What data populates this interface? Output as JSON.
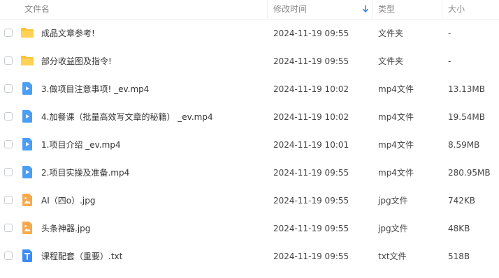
{
  "header": {
    "name": "文件名",
    "modified": "修改时间",
    "type": "类型",
    "size": "大小"
  },
  "files": [
    {
      "name": "成品文章参考!",
      "date": "2024-11-19 09:55",
      "type": "文件夹",
      "size": "-",
      "icon": "folder-icon"
    },
    {
      "name": "部分收益图及指令!",
      "date": "2024-11-19 09:55",
      "type": "文件夹",
      "size": "-",
      "icon": "folder-icon"
    },
    {
      "name": "3.做项目注意事项! _ev.mp4",
      "date": "2024-11-19 10:02",
      "type": "mp4文件",
      "size": "13.13MB",
      "icon": "video-icon"
    },
    {
      "name": "4.加餐课（批量高效写文章的秘籍） _ev.mp4",
      "date": "2024-11-19 10:02",
      "type": "mp4文件",
      "size": "19.54MB",
      "icon": "video-icon"
    },
    {
      "name": "1.项目介绍 _ev.mp4",
      "date": "2024-11-19 10:01",
      "type": "mp4文件",
      "size": "8.59MB",
      "icon": "video-icon"
    },
    {
      "name": "2.项目实操及准备.mp4",
      "date": "2024-11-19 09:55",
      "type": "mp4文件",
      "size": "280.95MB",
      "icon": "video-icon"
    },
    {
      "name": "AI（四o）.jpg",
      "date": "2024-11-19 09:55",
      "type": "jpg文件",
      "size": "742KB",
      "icon": "image-icon"
    },
    {
      "name": "头条神器.jpg",
      "date": "2024-11-19 09:55",
      "type": "jpg文件",
      "size": "48KB",
      "icon": "image-icon"
    },
    {
      "name": "课程配套（重要）.txt",
      "date": "2024-11-19 09:55",
      "type": "txt文件",
      "size": "518B",
      "icon": "text-file-icon"
    }
  ],
  "colors": {
    "folder": "#f9c434",
    "video": "#4a9ff5",
    "image": "#f7a94b",
    "text": "#3b8cf3",
    "sort_arrow": "#2f80ed"
  }
}
